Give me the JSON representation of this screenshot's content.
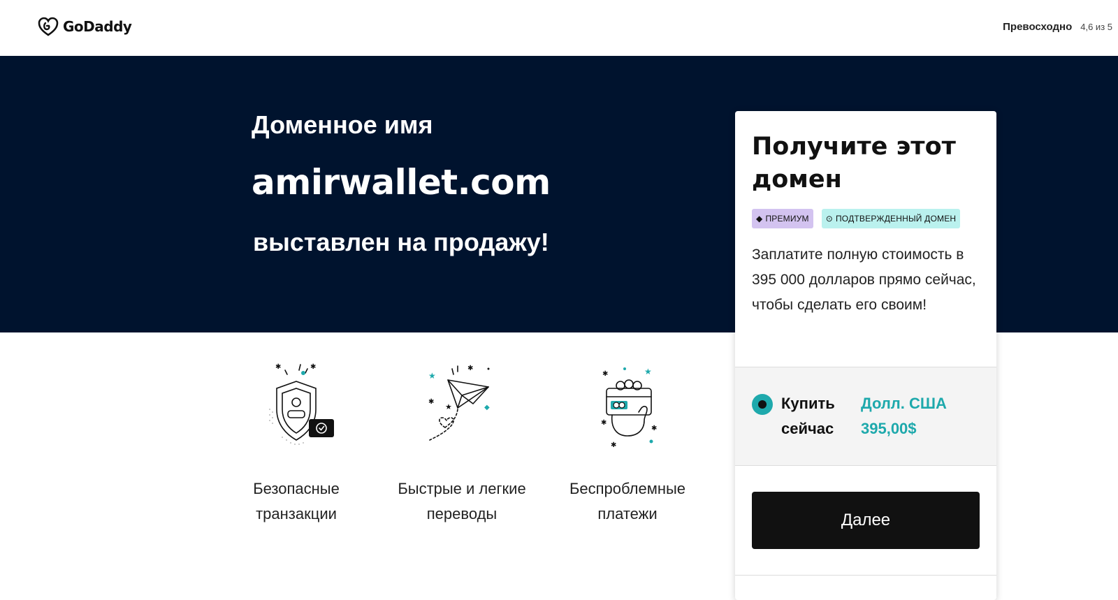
{
  "header": {
    "brand": "GoDaddy",
    "rating_label": "Превосходно",
    "rating_value": "4,6 из 5"
  },
  "hero": {
    "subtitle": "Доменное имя",
    "domain": "amirwallet.com",
    "sale_text": "выставлен на продажу!"
  },
  "features": [
    {
      "icon": "shield-check-icon",
      "label": "Безопасные транзакции"
    },
    {
      "icon": "paper-plane-icon",
      "label": "Быстрые и легкие переводы"
    },
    {
      "icon": "card-payment-icon",
      "label": "Беспроблемные платежи"
    }
  ],
  "card": {
    "title": "Получите этот домен",
    "badges": {
      "premium": "ПРЕМИУМ",
      "verified": "ПОДТВЕРЖДЕННЫЙ ДОМЕН"
    },
    "description": "Заплатите полную стоимость в 395 000 долларов прямо сейчас, чтобы сделать его своим!",
    "buy_now_label": "Купить сейчас",
    "buy_now_price": "Долл. США 395,00$",
    "next_button": "Далее"
  },
  "colors": {
    "hero_bg": "#00132e",
    "accent": "#1ea9ac",
    "button_bg": "#111111",
    "badge_premium": "#d3c3f0",
    "badge_verified": "#baf1ee"
  }
}
